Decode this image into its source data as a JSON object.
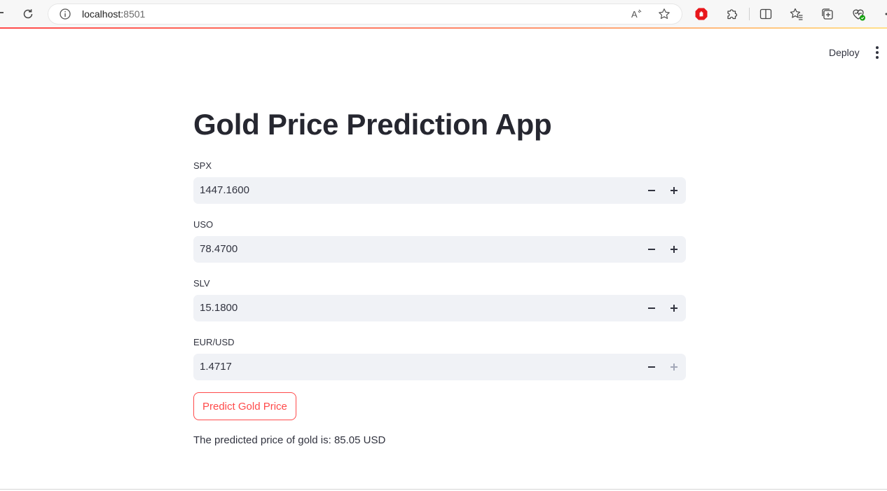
{
  "browser": {
    "url_host": "localhost:",
    "url_port": "8501",
    "accent": "#ff4b4b"
  },
  "header": {
    "deploy_label": "Deploy"
  },
  "app": {
    "title": "Gold Price Prediction App",
    "fields": [
      {
        "label": "SPX",
        "value": "1447.1600"
      },
      {
        "label": "USO",
        "value": "78.4700"
      },
      {
        "label": "SLV",
        "value": "15.1800"
      },
      {
        "label": "EUR/USD",
        "value": "1.4717"
      }
    ],
    "predict_button": "Predict Gold Price",
    "result_text": "The predicted price of gold is: 85.05 USD"
  },
  "icons": [
    "reload-icon",
    "info-icon",
    "read-aloud-icon",
    "favorite-star-icon",
    "adblock-icon",
    "extensions-icon",
    "split-screen-icon",
    "favorites-icon",
    "collections-icon",
    "browser-essentials-icon",
    "more-icon",
    "kebab-menu-icon",
    "minus-icon",
    "plus-icon"
  ]
}
